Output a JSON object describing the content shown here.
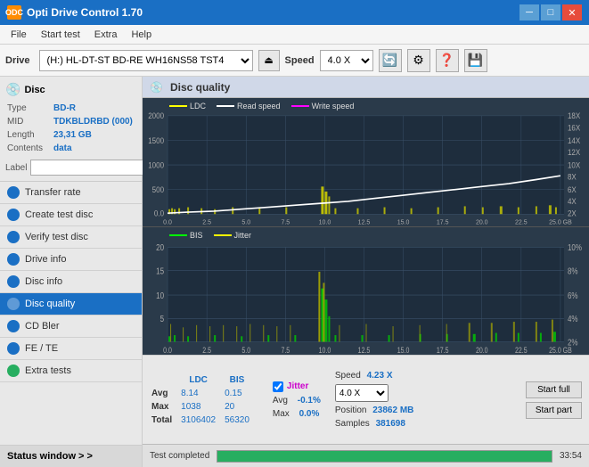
{
  "app": {
    "title": "Opti Drive Control 1.70",
    "icon": "ODC"
  },
  "title_controls": {
    "minimize": "─",
    "maximize": "□",
    "close": "✕"
  },
  "menu": {
    "items": [
      "File",
      "Start test",
      "Extra",
      "Help"
    ]
  },
  "toolbar": {
    "drive_label": "Drive",
    "drive_value": "(H:)  HL-DT-ST BD-RE  WH16NS58 TST4",
    "speed_label": "Speed",
    "speed_value": "4.0 X"
  },
  "disc": {
    "title": "Disc",
    "type_label": "Type",
    "type_value": "BD-R",
    "mid_label": "MID",
    "mid_value": "TDKBLDRBD (000)",
    "length_label": "Length",
    "length_value": "23,31 GB",
    "contents_label": "Contents",
    "contents_value": "data",
    "label_label": "Label",
    "label_value": ""
  },
  "nav": {
    "items": [
      {
        "id": "transfer-rate",
        "label": "Transfer rate",
        "active": false
      },
      {
        "id": "create-test-disc",
        "label": "Create test disc",
        "active": false
      },
      {
        "id": "verify-test-disc",
        "label": "Verify test disc",
        "active": false
      },
      {
        "id": "drive-info",
        "label": "Drive info",
        "active": false
      },
      {
        "id": "disc-info",
        "label": "Disc info",
        "active": false
      },
      {
        "id": "disc-quality",
        "label": "Disc quality",
        "active": true
      },
      {
        "id": "cd-bler",
        "label": "CD Bler",
        "active": false
      },
      {
        "id": "fe-te",
        "label": "FE / TE",
        "active": false
      },
      {
        "id": "extra-tests",
        "label": "Extra tests",
        "active": false
      }
    ],
    "status_window": "Status window > >"
  },
  "disc_quality": {
    "title": "Disc quality",
    "legend_top": [
      {
        "label": "LDC",
        "color": "#ffff00"
      },
      {
        "label": "Read speed",
        "color": "#ffffff"
      },
      {
        "label": "Write speed",
        "color": "#ff00ff"
      }
    ],
    "legend_bottom": [
      {
        "label": "BIS",
        "color": "#00ff00"
      },
      {
        "label": "Jitter",
        "color": "#ffff00"
      }
    ],
    "top_chart": {
      "y_labels_left": [
        "2000",
        "1500",
        "1000",
        "500",
        "0.0"
      ],
      "y_labels_right": [
        "18X",
        "16X",
        "14X",
        "12X",
        "10X",
        "8X",
        "6X",
        "4X",
        "2X"
      ],
      "x_labels": [
        "0.0",
        "2.5",
        "5.0",
        "7.5",
        "10.0",
        "12.5",
        "15.0",
        "17.5",
        "20.0",
        "22.5",
        "25.0 GB"
      ]
    },
    "bottom_chart": {
      "y_labels_left": [
        "20",
        "15",
        "10",
        "5",
        ""
      ],
      "y_labels_right": [
        "10%",
        "8%",
        "6%",
        "4%",
        "2%"
      ],
      "x_labels": [
        "0.0",
        "2.5",
        "5.0",
        "7.5",
        "10.0",
        "12.5",
        "15.0",
        "17.5",
        "20.0",
        "22.5",
        "25.0 GB"
      ]
    }
  },
  "stats": {
    "headers": [
      "",
      "LDC",
      "BIS"
    ],
    "avg_label": "Avg",
    "avg_ldc": "8.14",
    "avg_bis": "0.15",
    "max_label": "Max",
    "max_ldc": "1038",
    "max_bis": "20",
    "total_label": "Total",
    "total_ldc": "3106402",
    "total_bis": "56320",
    "jitter_label": "Jitter",
    "avg_jitter": "-0.1%",
    "max_jitter": "0.0%",
    "samples_label": "Samples",
    "samples_value": "381698",
    "speed_label": "Speed",
    "speed_value": "4.23 X",
    "speed_select": "4.0 X",
    "position_label": "Position",
    "position_value": "23862 MB",
    "btn_start_full": "Start full",
    "btn_start_part": "Start part"
  },
  "status_bar": {
    "text": "Test completed",
    "progress": 100,
    "time": "33:54"
  }
}
